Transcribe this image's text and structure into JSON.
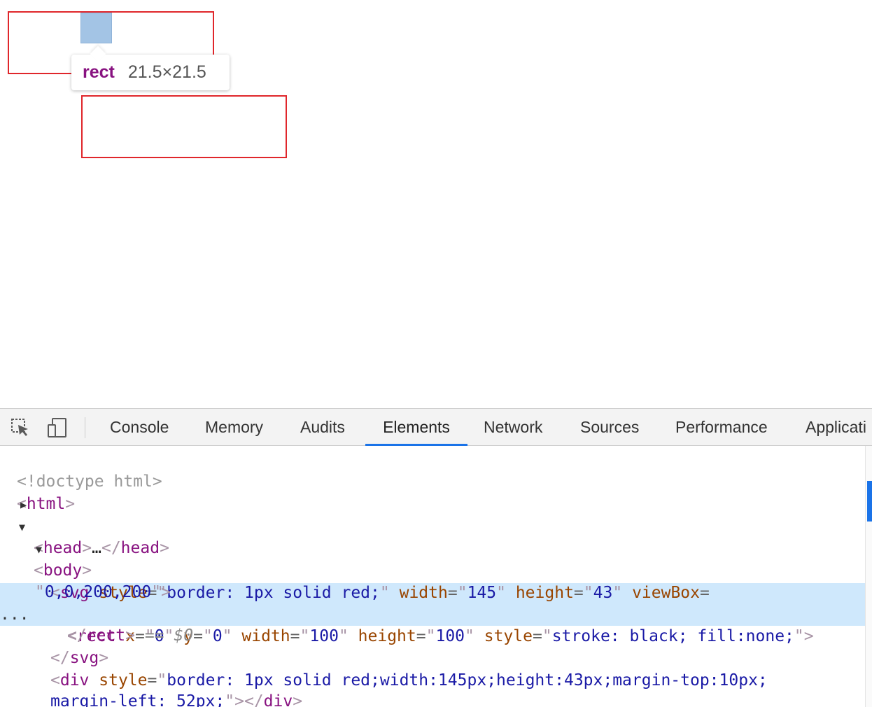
{
  "viewport": {
    "tooltip": {
      "tag": "rect",
      "dimensions": "21.5×21.5"
    }
  },
  "devtools": {
    "icons": [
      "inspect-element-icon",
      "device-toolbar-icon"
    ],
    "tabs": [
      {
        "id": "console",
        "label": "Console",
        "active": false
      },
      {
        "id": "memory",
        "label": "Memory",
        "active": false
      },
      {
        "id": "audits",
        "label": "Audits",
        "active": false
      },
      {
        "id": "elements",
        "label": "Elements",
        "active": true
      },
      {
        "id": "network",
        "label": "Network",
        "active": false
      },
      {
        "id": "sources",
        "label": "Sources",
        "active": false
      },
      {
        "id": "performance",
        "label": "Performance",
        "active": false
      },
      {
        "id": "application",
        "label": "Applicati",
        "active": false
      }
    ],
    "accent_color": "#1a73e8",
    "dom": {
      "doctype": "<!doctype html>",
      "html_tag": "html",
      "head_tag": "head",
      "head_ellipsis": "…",
      "body_tag": "body",
      "svg": {
        "tag": "svg",
        "attrs": [
          {
            "name": "style",
            "value": "border: 1px solid red;"
          },
          {
            "name": "width",
            "value": "145"
          },
          {
            "name": "height",
            "value": "43"
          },
          {
            "name": "viewBox",
            "value": "0,0,200,200"
          }
        ]
      },
      "rect": {
        "tag": "rect",
        "attrs": [
          {
            "name": "x",
            "value": "0"
          },
          {
            "name": "y",
            "value": "0"
          },
          {
            "name": "width",
            "value": "100"
          },
          {
            "name": "height",
            "value": "100"
          },
          {
            "name": "style",
            "value": "stroke: black; fill:none;"
          }
        ],
        "selected_marker": "== $0",
        "gutter": "..."
      },
      "div": {
        "tag": "div",
        "style_line1": "border: 1px solid red;width:145px;height:43px;margin-top:10px;",
        "style_line2": "margin-left: 52px;"
      }
    }
  }
}
